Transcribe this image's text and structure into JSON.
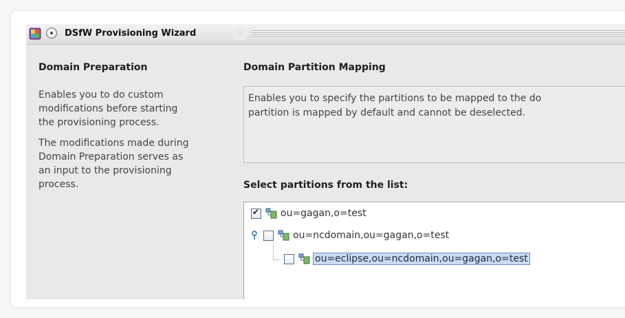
{
  "window": {
    "title": "DSfW Provisioning Wizard"
  },
  "left_pane": {
    "title": "Domain Preparation",
    "paragraph1": "Enables you to do custom\nmodifications before starting\nthe provisioning process.",
    "paragraph2": "The modifications made during\nDomain Preparation serves as\nan input to the provisioning\nprocess."
  },
  "main": {
    "title": "Domain Partition Mapping",
    "description": "Enables you to specify the partitions to be mapped to the do\npartition is mapped by default and cannot be deselected.",
    "select_label": "Select partitions from the list:"
  },
  "tree": {
    "items": [
      {
        "label": "ou=gagan,o=test",
        "checked": true,
        "level": 0
      },
      {
        "label": "ou=ncdomain,ou=gagan,o=test",
        "checked": false,
        "level": 0,
        "expandable": true
      },
      {
        "label": "ou=eclipse,ou=ncdomain,ou=gagan,o=test",
        "checked": false,
        "level": 1,
        "selected": true
      }
    ]
  },
  "icons": {
    "app": "wizard-app-icon",
    "radio": "radio-icon",
    "node": "tree-node-icon",
    "toggle": "expand-toggle-icon"
  },
  "colors": {
    "selection_bg": "#c9dbf2",
    "selection_border": "#6a8bc4",
    "toggle": "#2a6fb6"
  }
}
